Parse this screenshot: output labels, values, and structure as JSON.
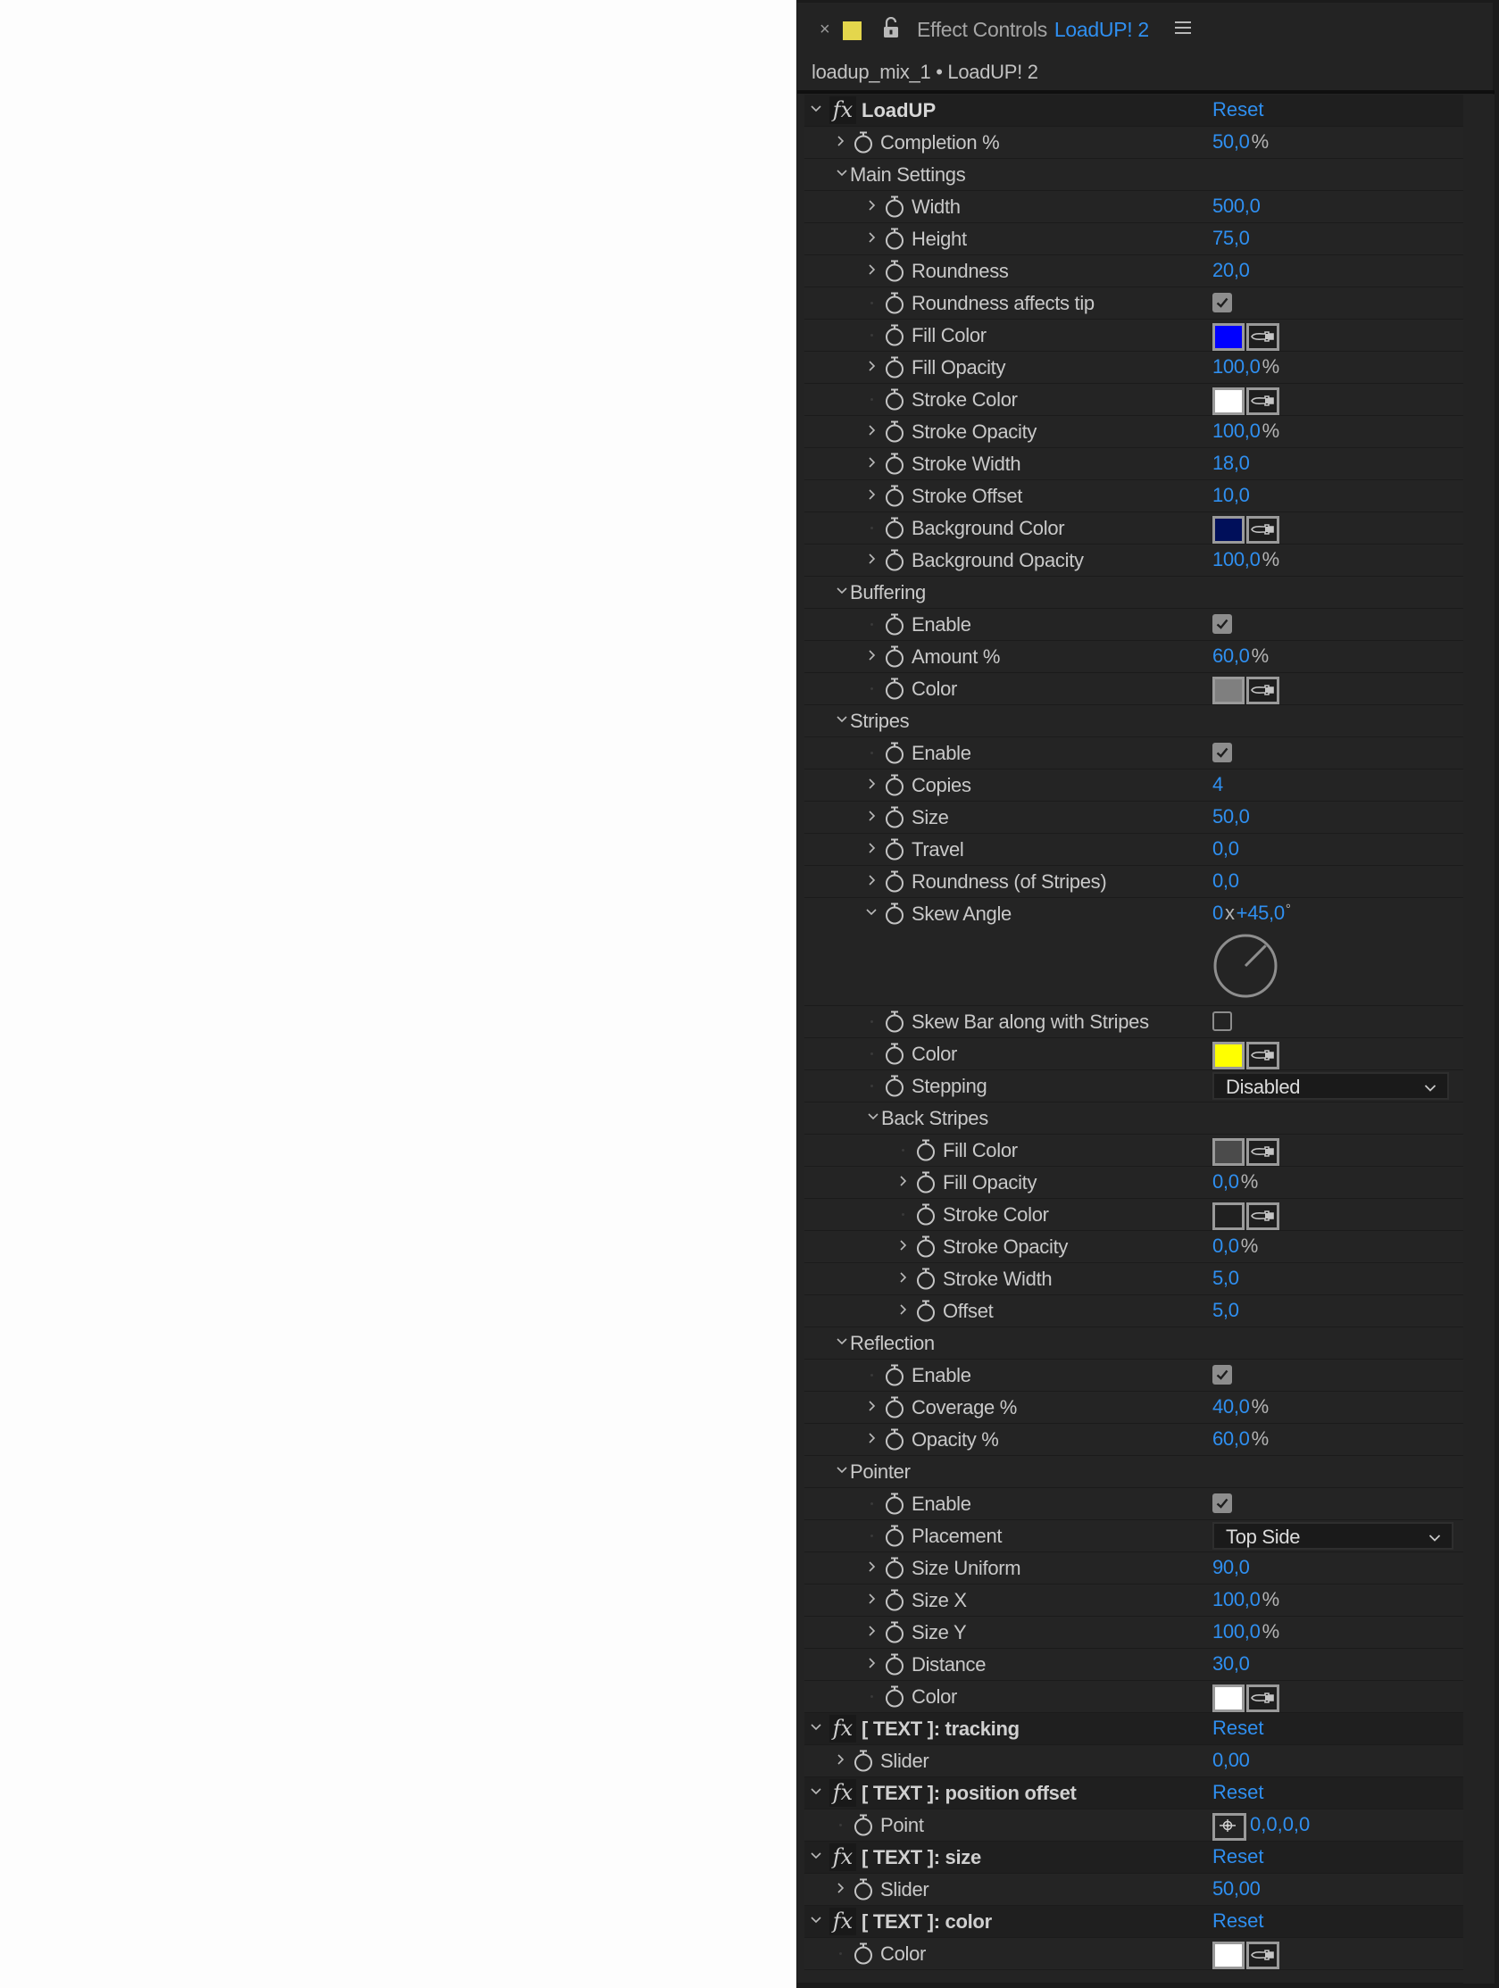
{
  "tab": {
    "close_icon": "×",
    "label_color": "#e4d64c",
    "title": "Effect Controls",
    "layer_name": "LoadUP! 2"
  },
  "breadcrumb": "loadup_mix_1 • LoadUP! 2",
  "colors": {
    "accent": "#2f8ff0",
    "panel_bg": "#232323",
    "text": "#c9c9c9"
  },
  "rows": [
    {
      "type": "effect",
      "level": 0,
      "label": "LoadUP",
      "reset": "Reset",
      "expanded": true
    },
    {
      "type": "param",
      "level": 1,
      "label": "Completion %",
      "value": "50,0",
      "unit": "%",
      "twirl": true
    },
    {
      "type": "group",
      "level": 1,
      "label": "Main Settings"
    },
    {
      "type": "param",
      "level": 2,
      "label": "Width",
      "value": "500,0",
      "twirl": true
    },
    {
      "type": "param",
      "level": 2,
      "label": "Height",
      "value": "75,0",
      "twirl": true
    },
    {
      "type": "param",
      "level": 2,
      "label": "Roundness",
      "value": "20,0",
      "twirl": true
    },
    {
      "type": "checkbox",
      "level": 2,
      "label": "Roundness affects tip",
      "checked": true
    },
    {
      "type": "color",
      "level": 2,
      "label": "Fill Color",
      "color": "#0000ff"
    },
    {
      "type": "param",
      "level": 2,
      "label": "Fill Opacity",
      "value": "100,0",
      "unit": "%",
      "twirl": true
    },
    {
      "type": "color",
      "level": 2,
      "label": "Stroke Color",
      "color": "#ffffff"
    },
    {
      "type": "param",
      "level": 2,
      "label": "Stroke Opacity",
      "value": "100,0",
      "unit": "%",
      "twirl": true
    },
    {
      "type": "param",
      "level": 2,
      "label": "Stroke Width",
      "value": "18,0",
      "twirl": true
    },
    {
      "type": "param",
      "level": 2,
      "label": "Stroke Offset",
      "value": "10,0",
      "twirl": true
    },
    {
      "type": "color",
      "level": 2,
      "label": "Background Color",
      "color": "#000f5a"
    },
    {
      "type": "param",
      "level": 2,
      "label": "Background Opacity",
      "value": "100,0",
      "unit": "%",
      "twirl": true
    },
    {
      "type": "group",
      "level": 1,
      "label": "Buffering"
    },
    {
      "type": "checkbox",
      "level": 2,
      "label": "Enable",
      "checked": true
    },
    {
      "type": "param",
      "level": 2,
      "label": "Amount %",
      "value": "60,0",
      "unit": "%",
      "twirl": true
    },
    {
      "type": "color",
      "level": 2,
      "label": "Color",
      "color": "#7f7f7f"
    },
    {
      "type": "group",
      "level": 1,
      "label": "Stripes"
    },
    {
      "type": "checkbox",
      "level": 2,
      "label": "Enable",
      "checked": true
    },
    {
      "type": "param",
      "level": 2,
      "label": "Copies",
      "value": "4",
      "twirl": true
    },
    {
      "type": "param",
      "level": 2,
      "label": "Size",
      "value": "50,0",
      "twirl": true
    },
    {
      "type": "param",
      "level": 2,
      "label": "Travel",
      "value": "0,0",
      "twirl": true
    },
    {
      "type": "param",
      "level": 2,
      "label": "Roundness (of Stripes)",
      "value": "0,0",
      "twirl": true
    },
    {
      "type": "angle",
      "level": 2,
      "label": "Skew Angle",
      "revolutions": "0",
      "separator": "x",
      "degrees": "+45,0",
      "degree_symbol": "°",
      "angle_deg": 45
    },
    {
      "type": "checkbox",
      "level": 2,
      "label": "Skew Bar along with Stripes",
      "checked": false
    },
    {
      "type": "color",
      "level": 2,
      "label": "Color",
      "color": "#ffff00"
    },
    {
      "type": "dropdown",
      "level": 2,
      "label": "Stepping",
      "value": "Disabled"
    },
    {
      "type": "group",
      "level": 2,
      "label": "Back Stripes"
    },
    {
      "type": "color",
      "level": 3,
      "label": "Fill Color",
      "color": "#4b4b4b"
    },
    {
      "type": "param",
      "level": 3,
      "label": "Fill Opacity",
      "value": "0,0",
      "unit": "%",
      "twirl": true
    },
    {
      "type": "color",
      "level": 3,
      "label": "Stroke Color",
      "color": "#202020"
    },
    {
      "type": "param",
      "level": 3,
      "label": "Stroke Opacity",
      "value": "0,0",
      "unit": "%",
      "twirl": true
    },
    {
      "type": "param",
      "level": 3,
      "label": "Stroke Width",
      "value": "5,0",
      "twirl": true
    },
    {
      "type": "param",
      "level": 3,
      "label": "Offset",
      "value": "5,0",
      "twirl": true
    },
    {
      "type": "group",
      "level": 1,
      "label": "Reflection"
    },
    {
      "type": "checkbox",
      "level": 2,
      "label": "Enable",
      "checked": true
    },
    {
      "type": "param",
      "level": 2,
      "label": "Coverage %",
      "value": "40,0",
      "unit": "%",
      "twirl": true
    },
    {
      "type": "param",
      "level": 2,
      "label": "Opacity %",
      "value": "60,0",
      "unit": "%",
      "twirl": true
    },
    {
      "type": "group",
      "level": 1,
      "label": "Pointer"
    },
    {
      "type": "checkbox",
      "level": 2,
      "label": "Enable",
      "checked": true
    },
    {
      "type": "dropdown",
      "level": 2,
      "label": "Placement",
      "value": "Top Side",
      "wide": true
    },
    {
      "type": "param",
      "level": 2,
      "label": "Size Uniform",
      "value": "90,0",
      "twirl": true
    },
    {
      "type": "param",
      "level": 2,
      "label": "Size X",
      "value": "100,0",
      "unit": "%",
      "twirl": true
    },
    {
      "type": "param",
      "level": 2,
      "label": "Size Y",
      "value": "100,0",
      "unit": "%",
      "twirl": true
    },
    {
      "type": "param",
      "level": 2,
      "label": "Distance",
      "value": "30,0",
      "twirl": true
    },
    {
      "type": "color",
      "level": 2,
      "label": "Color",
      "color": "#ffffff"
    },
    {
      "type": "effect",
      "level": 0,
      "label": "[ TEXT ]: tracking",
      "reset": "Reset",
      "expanded": true
    },
    {
      "type": "param",
      "level": 1,
      "label": "Slider",
      "value": "0,00",
      "twirl": true
    },
    {
      "type": "effect",
      "level": 0,
      "label": "[ TEXT ]: position offset",
      "reset": "Reset",
      "expanded": true
    },
    {
      "type": "point",
      "level": 1,
      "label": "Point",
      "value": "0,0,0,0"
    },
    {
      "type": "effect",
      "level": 0,
      "label": "[ TEXT ]: size",
      "reset": "Reset",
      "expanded": true
    },
    {
      "type": "param",
      "level": 1,
      "label": "Slider",
      "value": "50,00",
      "twirl": true
    },
    {
      "type": "effect",
      "level": 0,
      "label": "[ TEXT ]: color",
      "reset": "Reset",
      "expanded": true
    },
    {
      "type": "color",
      "level": 1,
      "label": "Color",
      "color": "#ffffff"
    }
  ]
}
